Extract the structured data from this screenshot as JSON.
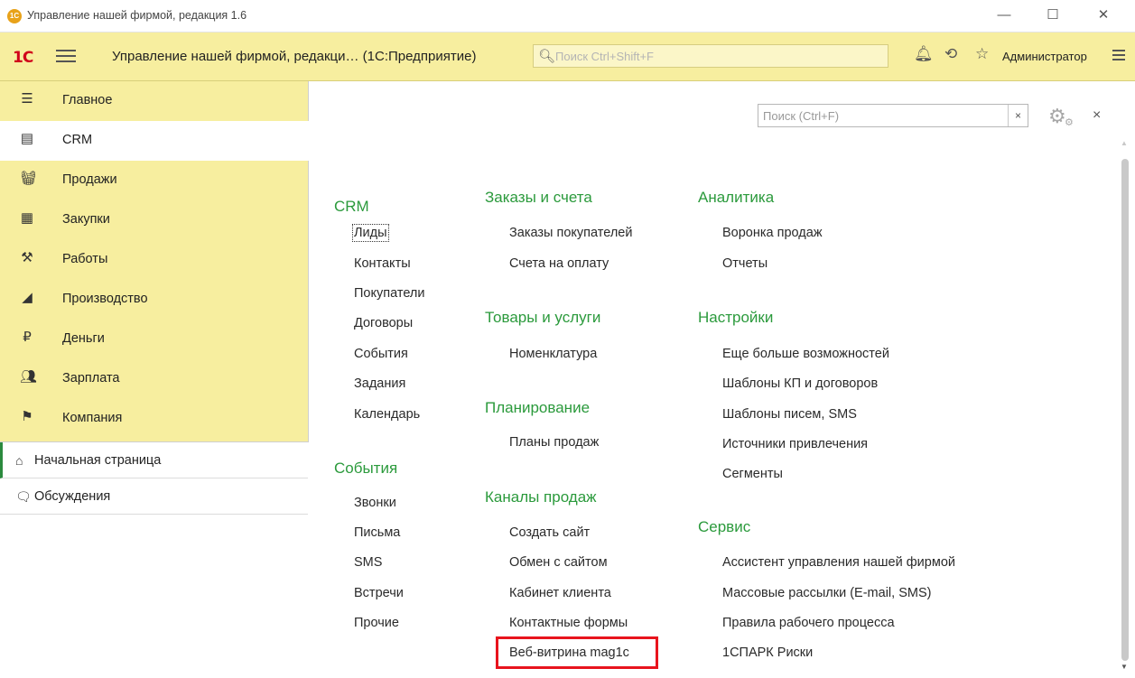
{
  "window": {
    "title": "Управление нашей фирмой, редакция 1.6",
    "logo_text": "1C",
    "minimize_glyph": "—",
    "maximize_glyph": "☐",
    "close_glyph": "✕"
  },
  "toolbar": {
    "logo_text": "1С",
    "app_title": "Управление нашей фирмой, редакци… (1С:Предприятие)",
    "search_placeholder": "Поиск Ctrl+Shift+F",
    "user": "Администратор"
  },
  "sidebar": {
    "sections": [
      {
        "label": "Главное",
        "icon": "list-icon"
      },
      {
        "label": "CRM",
        "icon": "crm-card-icon"
      },
      {
        "label": "Продажи",
        "icon": "basket-icon"
      },
      {
        "label": "Закупки",
        "icon": "cart-icon"
      },
      {
        "label": "Работы",
        "icon": "tools-icon"
      },
      {
        "label": "Производство",
        "icon": "factory-icon"
      },
      {
        "label": "Деньги",
        "icon": "ruble-coin-icon"
      },
      {
        "label": "Зарплата",
        "icon": "people-icon"
      },
      {
        "label": "Компания",
        "icon": "flag-icon"
      }
    ],
    "pages": [
      {
        "label": "Начальная страница",
        "icon": "home-icon"
      },
      {
        "label": "Обсуждения",
        "icon": "chat-icon"
      }
    ]
  },
  "form": {
    "search_placeholder": "Поиск (Ctrl+F)",
    "clear_glyph": "×",
    "close_glyph": "×"
  },
  "columns": {
    "col1": {
      "crm_title": "CRM",
      "crm_items": [
        "Лиды",
        "Контакты",
        "Покупатели",
        "Договоры",
        "События",
        "Задания",
        "Календарь"
      ],
      "events_title": "События",
      "events_items": [
        "Звонки",
        "Письма",
        "SMS",
        "Встречи",
        "Прочие"
      ]
    },
    "col2": {
      "orders_title": "Заказы и счета",
      "orders_items": [
        "Заказы покупателей",
        "Счета на оплату"
      ],
      "goods_title": "Товары и услуги",
      "goods_items": [
        "Номенклатура"
      ],
      "planning_title": "Планирование",
      "planning_items": [
        "Планы продаж"
      ],
      "channels_title": "Каналы продаж",
      "channels_items": [
        "Создать сайт",
        "Обмен с сайтом",
        "Кабинет клиента",
        "Контактные формы",
        "Веб-витрина mag1c"
      ]
    },
    "col3": {
      "analytics_title": "Аналитика",
      "analytics_items": [
        "Воронка продаж",
        "Отчеты"
      ],
      "settings_title": "Настройки",
      "settings_items": [
        "Еще больше возможностей",
        "Шаблоны КП и договоров",
        "Шаблоны писем, SMS",
        "Источники привлечения",
        "Сегменты"
      ],
      "service_title": "Сервис",
      "service_items": [
        "Ассистент управления нашей фирмой",
        "Массовые рассылки (E-mail, SMS)",
        "Правила рабочего процесса",
        "1СПАРК Риски"
      ]
    }
  },
  "colors": {
    "section_green": "#2b9a3c",
    "sidebar_yellow": "#f7ee9f",
    "highlight_red": "#e8141d"
  }
}
